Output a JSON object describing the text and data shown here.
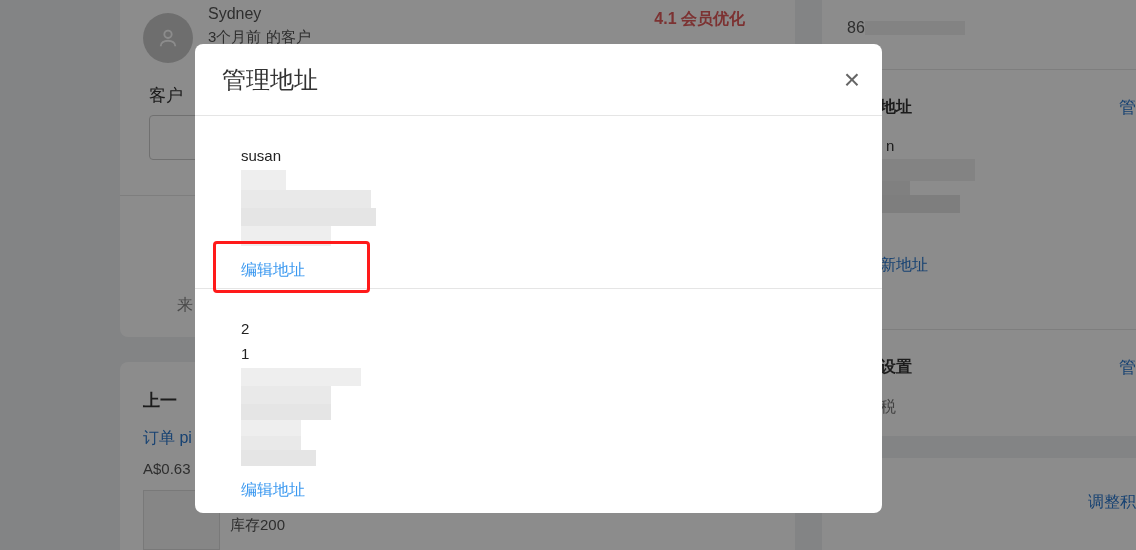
{
  "background": {
    "customer": {
      "name": "Sydney",
      "since": "3个月前 的客户",
      "badge": "4.1 会员优化",
      "note_label": "客户"
    },
    "card_text": "来",
    "last_order": {
      "title": "上一",
      "order_link": "订单 pi",
      "price": "A$0.63",
      "stock": "库存200"
    },
    "right_panel": {
      "phone": "86",
      "address_title": "地址",
      "address_action": "管",
      "address_line": "n",
      "add_address": "新地址",
      "settings_title": "设置",
      "settings_action": "管",
      "settings_value": "税",
      "points_action": "调整积"
    }
  },
  "dialog": {
    "title": "管理地址",
    "close": "×",
    "addresses": [
      {
        "lines": [
          "susan"
        ],
        "action": "编辑地址",
        "highlighted": true
      },
      {
        "lines": [
          "2",
          "1"
        ],
        "action": "编辑地址",
        "highlighted": false
      }
    ]
  }
}
